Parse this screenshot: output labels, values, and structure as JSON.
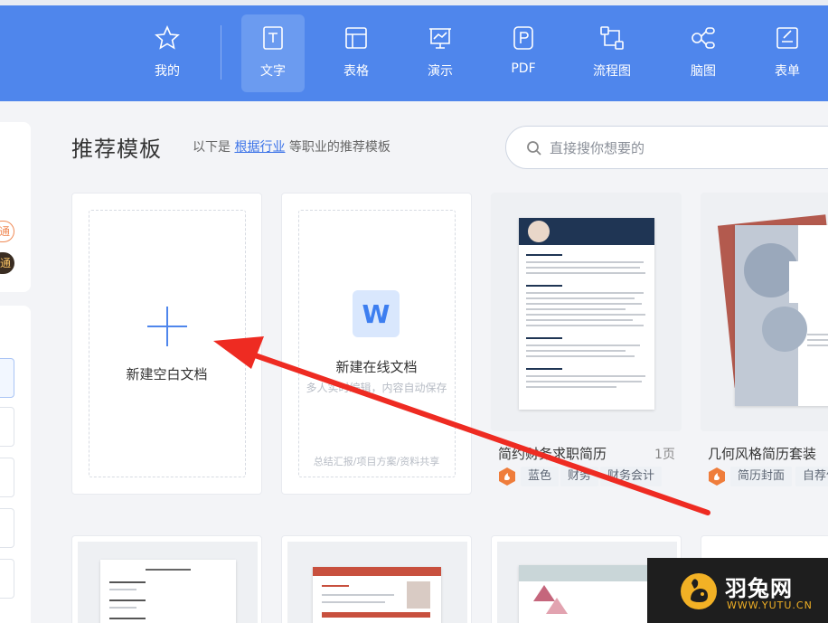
{
  "toolbar": {
    "items": [
      {
        "label": "我的",
        "icon": "star-icon"
      },
      {
        "label": "文字",
        "icon": "document-icon",
        "active": true
      },
      {
        "label": "表格",
        "icon": "table-icon"
      },
      {
        "label": "演示",
        "icon": "presentation-icon"
      },
      {
        "label": "PDF",
        "icon": "pdf-icon"
      },
      {
        "label": "流程图",
        "icon": "flowchart-icon"
      },
      {
        "label": "脑图",
        "icon": "mindmap-icon"
      },
      {
        "label": "表单",
        "icon": "form-icon"
      }
    ],
    "bg_color": "#4f86ec",
    "active_color": "#6b9bf0"
  },
  "sidebar": {
    "tag1": "通",
    "tag2": "通"
  },
  "header": {
    "title": "推荐模板",
    "subtitle_prefix": "以下是",
    "subtitle_link": "根据行业",
    "subtitle_suffix": "等职业的推荐模板"
  },
  "search": {
    "placeholder": "直接搜你想要的"
  },
  "cards": {
    "blank": {
      "label": "新建空白文档"
    },
    "online": {
      "icon_letter": "W",
      "label": "新建在线文档",
      "hint": "多人实时编辑，内容自动保存",
      "footer": "总结汇报/项目方案/资料共享"
    }
  },
  "templates": [
    {
      "name": "简约财务求职简历",
      "pages": "1页",
      "tags": [
        "蓝色",
        "财务",
        "财务会计"
      ]
    },
    {
      "name": "几何风格简历套装",
      "pages": "",
      "tags": [
        "简历封面",
        "自荐信"
      ]
    }
  ],
  "watermark": {
    "brand": "羽兔网",
    "url": "WWW.YUTU.CN"
  }
}
